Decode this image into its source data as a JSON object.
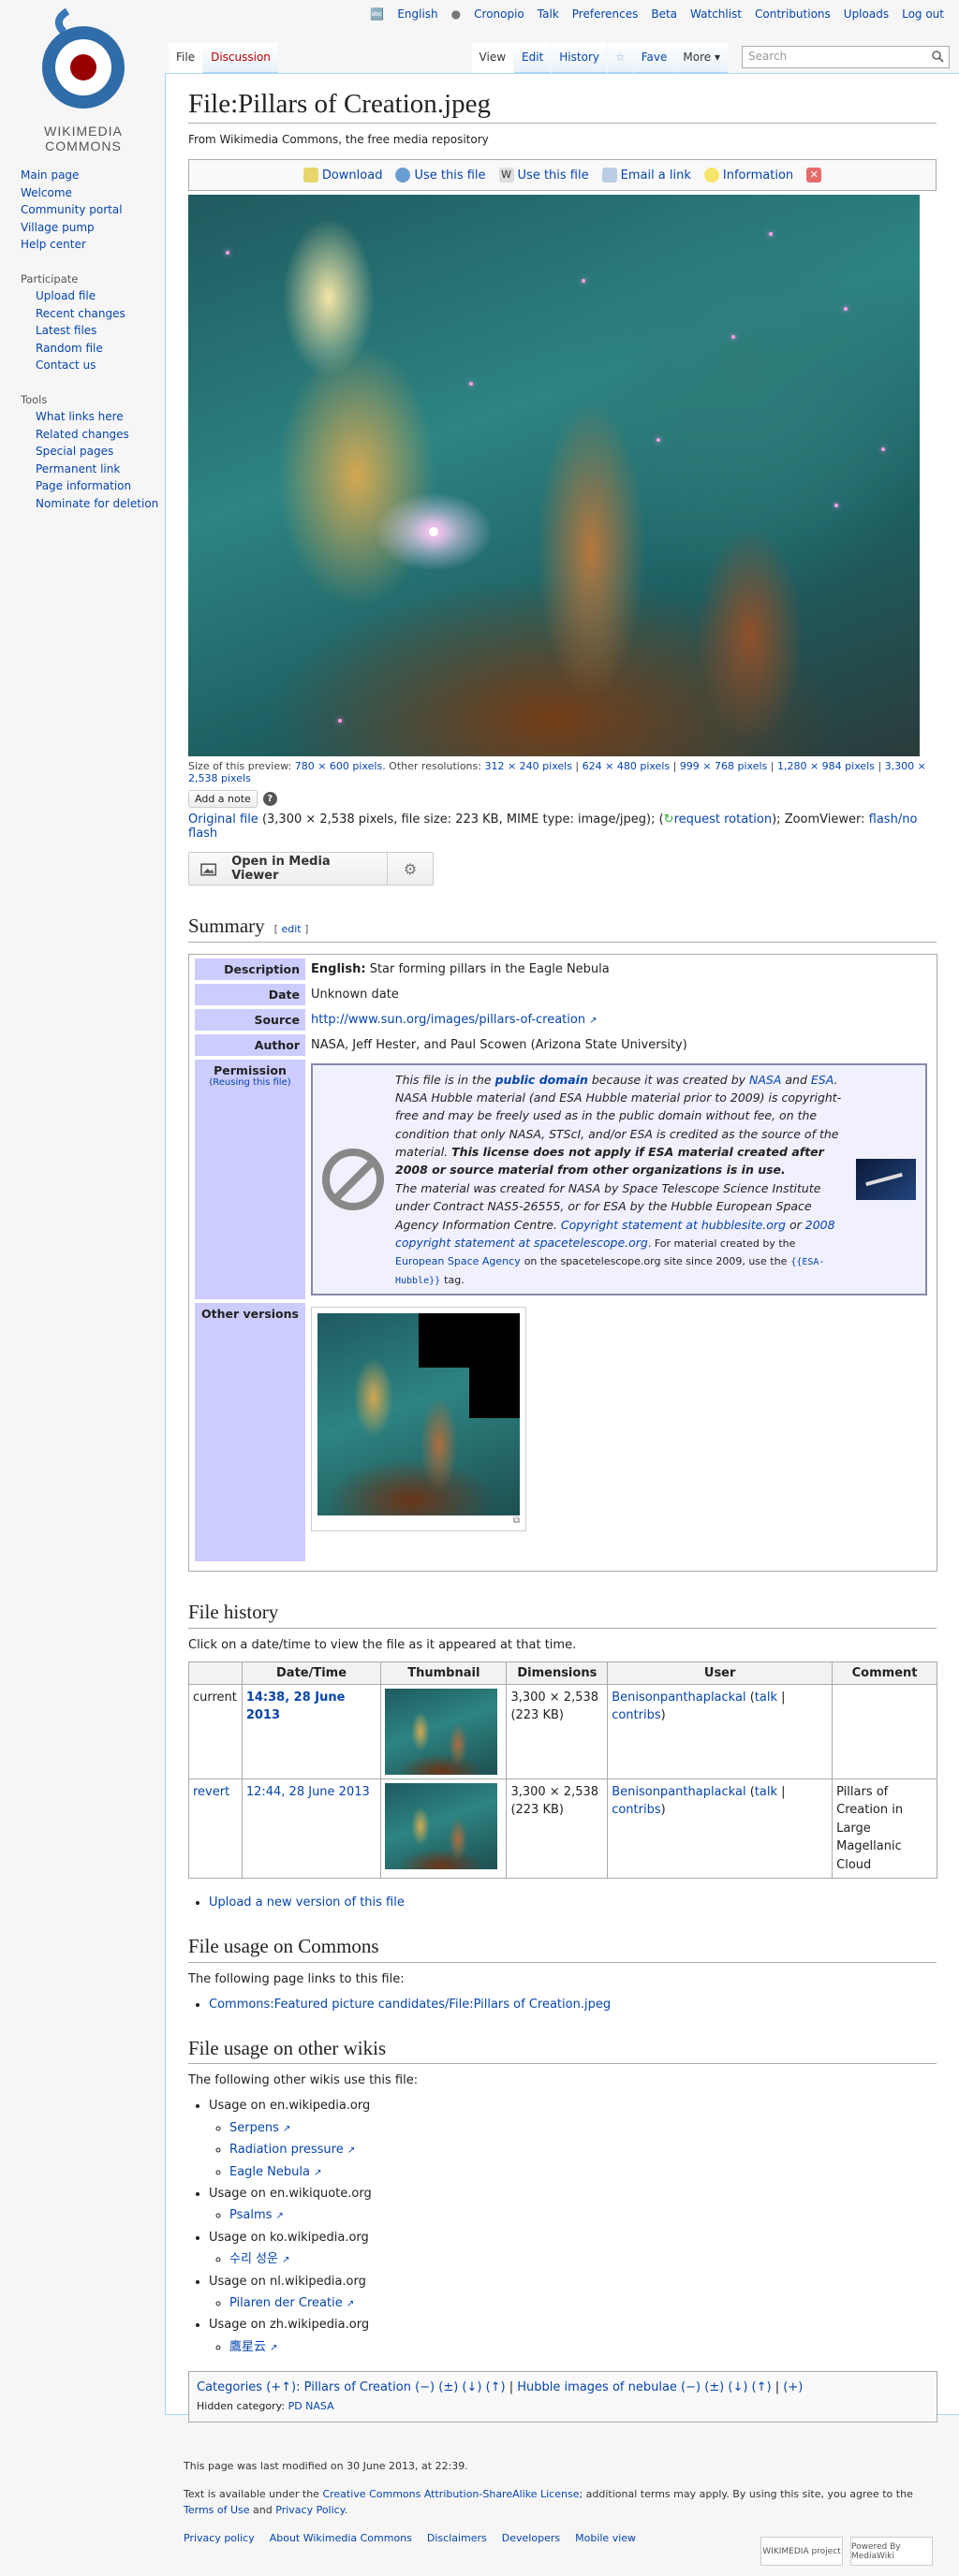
{
  "logo": {
    "line1": "WIKIMEDIA",
    "line2": "COMMONS"
  },
  "personal": [
    "English",
    "Cronopio",
    "Talk",
    "Preferences",
    "Beta",
    "Watchlist",
    "Contributions",
    "Uploads",
    "Log out"
  ],
  "tabs_left": [
    "File",
    "Discussion"
  ],
  "tabs_right": [
    "View",
    "Edit",
    "History",
    "Fave",
    "More"
  ],
  "search": {
    "placeholder": "Search"
  },
  "sidebar": {
    "main": [
      "Main page",
      "Welcome",
      "Community portal",
      "Village pump",
      "Help center"
    ],
    "participate_head": "Participate",
    "participate": [
      "Upload file",
      "Recent changes",
      "Latest files",
      "Random file",
      "Contact us"
    ],
    "tools_head": "Tools",
    "tools": [
      "What links here",
      "Related changes",
      "Special pages",
      "Permanent link",
      "Page information",
      "Nominate for deletion"
    ]
  },
  "page": {
    "title": "File:Pillars of Creation.jpeg",
    "sitesub": "From Wikimedia Commons, the free media repository",
    "filetoc": [
      "Download",
      "Use this file",
      "Use this file",
      "Email a link",
      "Information"
    ],
    "res_prefix": "Size of this preview:",
    "res_preview": "780 × 600 pixels",
    "res_other": ". Other resolutions:",
    "resolutions": [
      "312 × 240 pixels",
      "624 × 480 pixels",
      "999 × 768 pixels",
      "1,280 × 984 pixels",
      "3,300 × 2,538 pixels"
    ],
    "add_note": "Add a note",
    "original_file": "Original file",
    "original_info": "(3,300 × 2,538 pixels, file size: 223 KB, MIME type: image/jpeg); (",
    "request_rotation": "request rotation",
    "zoom_prefix": "); ZoomViewer:",
    "zoom_link": "flash/no flash",
    "mediaviewer": "Open in Media Viewer"
  },
  "summary": {
    "heading": "Summary",
    "edit": "edit",
    "description_label": "Description",
    "description_lang": "English:",
    "description": "Star forming pillars in the Eagle Nebula",
    "date_label": "Date",
    "date": "Unknown date",
    "source_label": "Source",
    "source": "http://www.sun.org/images/pillars-of-creation",
    "author_label": "Author",
    "author": "NASA, Jeff Hester, and Paul Scowen (Arizona State University)",
    "permission_label": "Permission",
    "reusing": "(Reusing this file)",
    "license_p1": "This file is in the",
    "license_pd": "public domain",
    "license_p2": "because it was created by",
    "license_nasa": "NASA",
    "license_and": "and",
    "license_esa": "ESA",
    "license_p3": ". NASA Hubble material (and ESA Hubble material prior to 2009) is copyright-free and may be freely used as in the public domain without fee, on the condition that only NASA, STScI, and/or ESA is credited as the source of the material.",
    "license_bold": "This license does not apply if ESA material created after 2008 or source material from other organizations is in use.",
    "license_p4": "The material was created for NASA by Space Telescope Science Institute under Contract NAS5-26555, or for ESA by the Hubble European Space Agency Information Centre.",
    "license_link1": "Copyright statement at hubblesite.org",
    "license_or": "or",
    "license_link2": "2008 copyright statement at spacetelescope.org",
    "license_small1": ". For material created by the",
    "license_esa_link": "European Space Agency",
    "license_small2": "on the spacetelescope.org site since 2009, use the",
    "license_tpl": "{{ESA-Hubble}}",
    "license_small3": "tag.",
    "other_versions_label": "Other versions"
  },
  "history": {
    "heading": "File history",
    "intro": "Click on a date/time to view the file as it appeared at that time.",
    "columns": [
      "",
      "Date/Time",
      "Thumbnail",
      "Dimensions",
      "User",
      "Comment"
    ],
    "rows": [
      {
        "status": "current",
        "date": "14:38, 28 June 2013",
        "dims": "3,300 × 2,538",
        "size": "(223 KB)",
        "user": "Benisonpanthaplackal",
        "talk": "talk",
        "contribs": "contribs",
        "comment": ""
      },
      {
        "status": "revert",
        "date": "12:44, 28 June 2013",
        "dims": "3,300 × 2,538",
        "size": "(223 KB)",
        "user": "Benisonpanthaplackal",
        "talk": "talk",
        "contribs": "contribs",
        "comment": "Pillars of Creation in Large Magellanic Cloud"
      }
    ],
    "upload_new": "Upload a new version of this file"
  },
  "usage": {
    "heading": "File usage on Commons",
    "intro": "The following page links to this file:",
    "links": [
      "Commons:Featured picture candidates/File:Pillars of Creation.jpeg"
    ]
  },
  "global": {
    "heading": "File usage on other wikis",
    "intro": "The following other wikis use this file:",
    "wikis": [
      {
        "name": "Usage on en.wikipedia.org",
        "pages": [
          "Serpens",
          "Radiation pressure",
          "Eagle Nebula"
        ]
      },
      {
        "name": "Usage on en.wikiquote.org",
        "pages": [
          "Psalms"
        ]
      },
      {
        "name": "Usage on ko.wikipedia.org",
        "pages": [
          "수리 성운"
        ]
      },
      {
        "name": "Usage on nl.wikipedia.org",
        "pages": [
          "Pilaren der Creatie"
        ]
      },
      {
        "name": "Usage on zh.wikipedia.org",
        "pages": [
          "鷹星云"
        ]
      }
    ]
  },
  "categories": {
    "label": "Categories (+↑):",
    "cat1": "Pillars of Creation",
    "cat2": "Hubble images of nebulae",
    "controls": "(−) (±) (↓) (↑)",
    "plus": "(+)",
    "hidden_label": "Hidden category:",
    "hidden": "PD NASA"
  },
  "footer": {
    "modified": "This page was last modified on 30 June 2013, at 22:39.",
    "license_a": "Text is available under the",
    "license_link": "Creative Commons Attribution-ShareAlike License",
    "license_b": "; additional terms may apply. By using this site, you agree to the",
    "terms": "Terms of Use",
    "license_c": "and",
    "privacy_policy": "Privacy Policy",
    "links": [
      "Privacy policy",
      "About Wikimedia Commons",
      "Disclaimers",
      "Developers",
      "Mobile view"
    ],
    "badge1": "WIKIMEDIA project",
    "badge2": "Powered By MediaWiki"
  },
  "colors": {
    "link": "#0645ad",
    "new_link": "#ba0000",
    "label_bg": "#ccccff",
    "border": "#a7d7f9"
  }
}
